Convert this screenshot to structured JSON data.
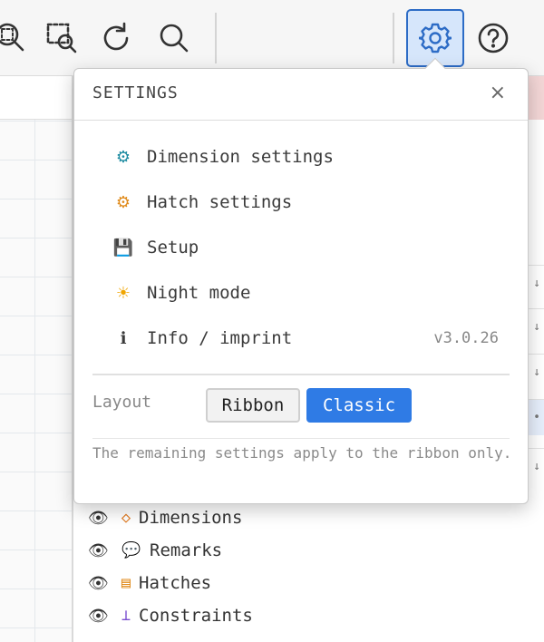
{
  "toolbar": {
    "tools": [
      {
        "icon": "zoom-extents-icon"
      },
      {
        "icon": "zoom-window-icon"
      },
      {
        "icon": "redraw-icon"
      },
      {
        "icon": "zoom-icon"
      },
      {
        "icon": "gear-icon",
        "active": true
      },
      {
        "icon": "help-icon"
      }
    ]
  },
  "settings": {
    "title": "SETTINGS",
    "close": "×",
    "items": [
      {
        "label": "Dimension settings",
        "icon": "⚙",
        "icon_name": "dimension-gear-icon",
        "icon_color": "#1a8aa0"
      },
      {
        "label": "Hatch settings",
        "icon": "⚙",
        "icon_name": "hatch-gear-icon",
        "icon_color": "#e08a1a"
      },
      {
        "label": "Setup",
        "icon": "💾",
        "icon_name": "floppy-disk-icon"
      },
      {
        "label": "Night mode",
        "icon": "☀",
        "icon_name": "sun-icon",
        "icon_color": "#f0a500"
      },
      {
        "label": "Info / imprint",
        "icon": "ℹ",
        "icon_name": "info-icon",
        "extra": "v3.0.26"
      }
    ],
    "layout_label": "Layout",
    "layout_options": [
      "Ribbon",
      "Classic"
    ],
    "layout_selected": "Classic",
    "note": "The remaining settings apply to the ribbon only."
  },
  "layers": [
    {
      "label": "Dimensions",
      "icon": "◇",
      "icon_name": "diamond-icon",
      "icon_color": "#e07a20"
    },
    {
      "label": "Remarks",
      "icon": "💬",
      "icon_name": "speech-bubble-icon"
    },
    {
      "label": "Hatches",
      "icon": "▤",
      "icon_name": "hatch-icon",
      "icon_color": "#e08a1a"
    },
    {
      "label": "Constraints",
      "icon": "⊥",
      "icon_name": "perpendicular-icon",
      "icon_color": "#7a4fd0"
    }
  ],
  "colors": {
    "accent": "#2f7be5",
    "active_tool_bg": "#d6e6fb"
  }
}
